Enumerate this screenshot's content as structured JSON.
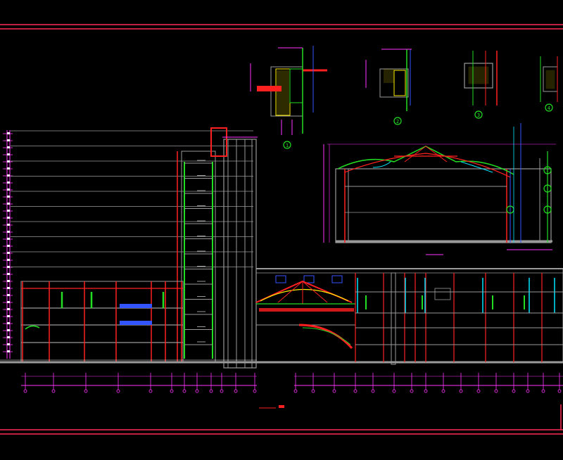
{
  "drawing": {
    "background": "#000000",
    "palette": {
      "frame": "#ff2a55",
      "grey": "#9a9a9a",
      "red": "#ff2020",
      "green": "#22dd22",
      "yellow": "#ffee00",
      "magenta": "#ff33ff",
      "cyan": "#00e5ff",
      "blue": "#3355ff",
      "white": "#ffffff"
    },
    "details": [
      {
        "number": "1",
        "label": "1"
      },
      {
        "number": "2",
        "label": "2"
      },
      {
        "number": "3",
        "label": "3"
      },
      {
        "number": "4",
        "label": "4"
      }
    ]
  }
}
